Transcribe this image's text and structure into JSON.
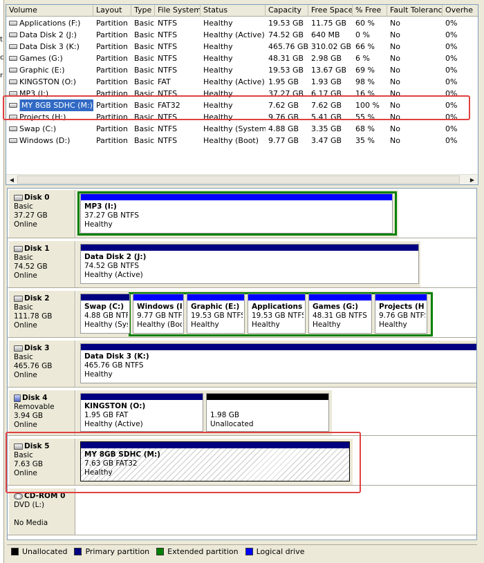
{
  "columns": [
    "Volume",
    "Layout",
    "Type",
    "File System",
    "Status",
    "Capacity",
    "Free Space",
    "% Free",
    "Fault Tolerance",
    "Overhe"
  ],
  "volumes": [
    {
      "name": "Applications (F:)",
      "layout": "Partition",
      "type": "Basic",
      "fs": "NTFS",
      "status": "Healthy",
      "capacity": "19.53 GB",
      "free": "11.75 GB",
      "pct": "60 %",
      "fault": "No",
      "overhead": "0%"
    },
    {
      "name": "Data Disk 2 (J:)",
      "layout": "Partition",
      "type": "Basic",
      "fs": "NTFS",
      "status": "Healthy (Active)",
      "capacity": "74.52 GB",
      "free": "640 MB",
      "pct": "0 %",
      "fault": "No",
      "overhead": "0%"
    },
    {
      "name": "Data Disk 3 (K:)",
      "layout": "Partition",
      "type": "Basic",
      "fs": "NTFS",
      "status": "Healthy",
      "capacity": "465.76 GB",
      "free": "310.02 GB",
      "pct": "66 %",
      "fault": "No",
      "overhead": "0%"
    },
    {
      "name": "Games (G:)",
      "layout": "Partition",
      "type": "Basic",
      "fs": "NTFS",
      "status": "Healthy",
      "capacity": "48.31 GB",
      "free": "2.98 GB",
      "pct": "6 %",
      "fault": "No",
      "overhead": "0%"
    },
    {
      "name": "Graphic (E:)",
      "layout": "Partition",
      "type": "Basic",
      "fs": "NTFS",
      "status": "Healthy",
      "capacity": "19.53 GB",
      "free": "13.67 GB",
      "pct": "69 %",
      "fault": "No",
      "overhead": "0%"
    },
    {
      "name": "KINGSTON (O:)",
      "layout": "Partition",
      "type": "Basic",
      "fs": "FAT",
      "status": "Healthy (Active)",
      "capacity": "1.95 GB",
      "free": "1.93 GB",
      "pct": "98 %",
      "fault": "No",
      "overhead": "0%"
    },
    {
      "name": "MP3 (I:)",
      "layout": "Partition",
      "type": "Basic",
      "fs": "NTFS",
      "status": "Healthy",
      "capacity": "37.27 GB",
      "free": "6.17 GB",
      "pct": "16 %",
      "fault": "No",
      "overhead": "0%"
    },
    {
      "name": "MY 8GB SDHC (M:)",
      "layout": "Partition",
      "type": "Basic",
      "fs": "FAT32",
      "status": "Healthy",
      "capacity": "7.62 GB",
      "free": "7.62 GB",
      "pct": "100 %",
      "fault": "No",
      "overhead": "0%",
      "selected": true
    },
    {
      "name": "Projects (H:)",
      "layout": "Partition",
      "type": "Basic",
      "fs": "NTFS",
      "status": "Healthy",
      "capacity": "9.76 GB",
      "free": "5.41 GB",
      "pct": "55 %",
      "fault": "No",
      "overhead": "0%"
    },
    {
      "name": "Swap (C:)",
      "layout": "Partition",
      "type": "Basic",
      "fs": "NTFS",
      "status": "Healthy (System)",
      "capacity": "4.88 GB",
      "free": "3.35 GB",
      "pct": "68 %",
      "fault": "No",
      "overhead": "0%"
    },
    {
      "name": "Windows (D:)",
      "layout": "Partition",
      "type": "Basic",
      "fs": "NTFS",
      "status": "Healthy (Boot)",
      "capacity": "9.77 GB",
      "free": "3.47 GB",
      "pct": "35 %",
      "fault": "No",
      "overhead": "0%"
    }
  ],
  "disks": [
    {
      "name": "Disk 0",
      "kind": "Basic",
      "size": "37.27 GB",
      "state": "Online",
      "icon": "hard-disk-icon",
      "partitions": [
        {
          "title": "MP3  (I:)",
          "detail": "37.27 GB NTFS",
          "status": "Healthy"
        }
      ]
    },
    {
      "name": "Disk 1",
      "kind": "Basic",
      "size": "74.52 GB",
      "state": "Online",
      "icon": "hard-disk-icon",
      "partitions": [
        {
          "title": "Data Disk 2  (J:)",
          "detail": "74.52 GB NTFS",
          "status": "Healthy (Active)"
        }
      ]
    },
    {
      "name": "Disk 2",
      "kind": "Basic",
      "size": "111.78 GB",
      "state": "Online",
      "icon": "hard-disk-icon",
      "partitions": [
        {
          "title": "Swap  (C:)",
          "detail": "4.88 GB NTF",
          "status": "Healthy (Sys"
        },
        {
          "title": "Windows  (I",
          "detail": "9.77 GB NTF",
          "status": "Healthy (Boo"
        },
        {
          "title": "Graphic  (E:)",
          "detail": "19.53 GB NTFS",
          "status": "Healthy"
        },
        {
          "title": "Applications",
          "detail": "19.53 GB NTFS",
          "status": "Healthy"
        },
        {
          "title": "Games  (G:)",
          "detail": "48.31 GB NTFS",
          "status": "Healthy"
        },
        {
          "title": "Projects  (H",
          "detail": "9.76 GB NTFS",
          "status": "Healthy"
        }
      ]
    },
    {
      "name": "Disk 3",
      "kind": "Basic",
      "size": "465.76 GB",
      "state": "Online",
      "icon": "hard-disk-icon",
      "partitions": [
        {
          "title": "Data Disk 3  (K:)",
          "detail": "465.76 GB NTFS",
          "status": "Healthy"
        }
      ]
    },
    {
      "name": "Disk 4",
      "kind": "Removable",
      "size": "3.94 GB",
      "state": "Online",
      "icon": "removable-disk-icon",
      "partitions": [
        {
          "title": "KINGSTON  (O:)",
          "detail": "1.95 GB FAT",
          "status": "Healthy (Active)"
        },
        {
          "title": "",
          "detail": "1.98 GB",
          "status": "Unallocated"
        }
      ]
    },
    {
      "name": "Disk 5",
      "kind": "Basic",
      "size": "7.63 GB",
      "state": "Online",
      "icon": "hard-disk-icon",
      "partitions": [
        {
          "title": "MY 8GB SDHC  (M:)",
          "detail": "7.63 GB FAT32",
          "status": "Healthy"
        }
      ]
    },
    {
      "name": "CD-ROM 0",
      "kind": "DVD (L:)",
      "size": "",
      "state": "No Media",
      "icon": "cdrom-icon",
      "partitions": []
    }
  ],
  "legend": [
    {
      "label": "Unallocated",
      "color": "#000000"
    },
    {
      "label": "Primary partition",
      "color": "#000080"
    },
    {
      "label": "Extended partition",
      "color": "#008000"
    },
    {
      "label": "Logical drive",
      "color": "#0000ff"
    }
  ]
}
